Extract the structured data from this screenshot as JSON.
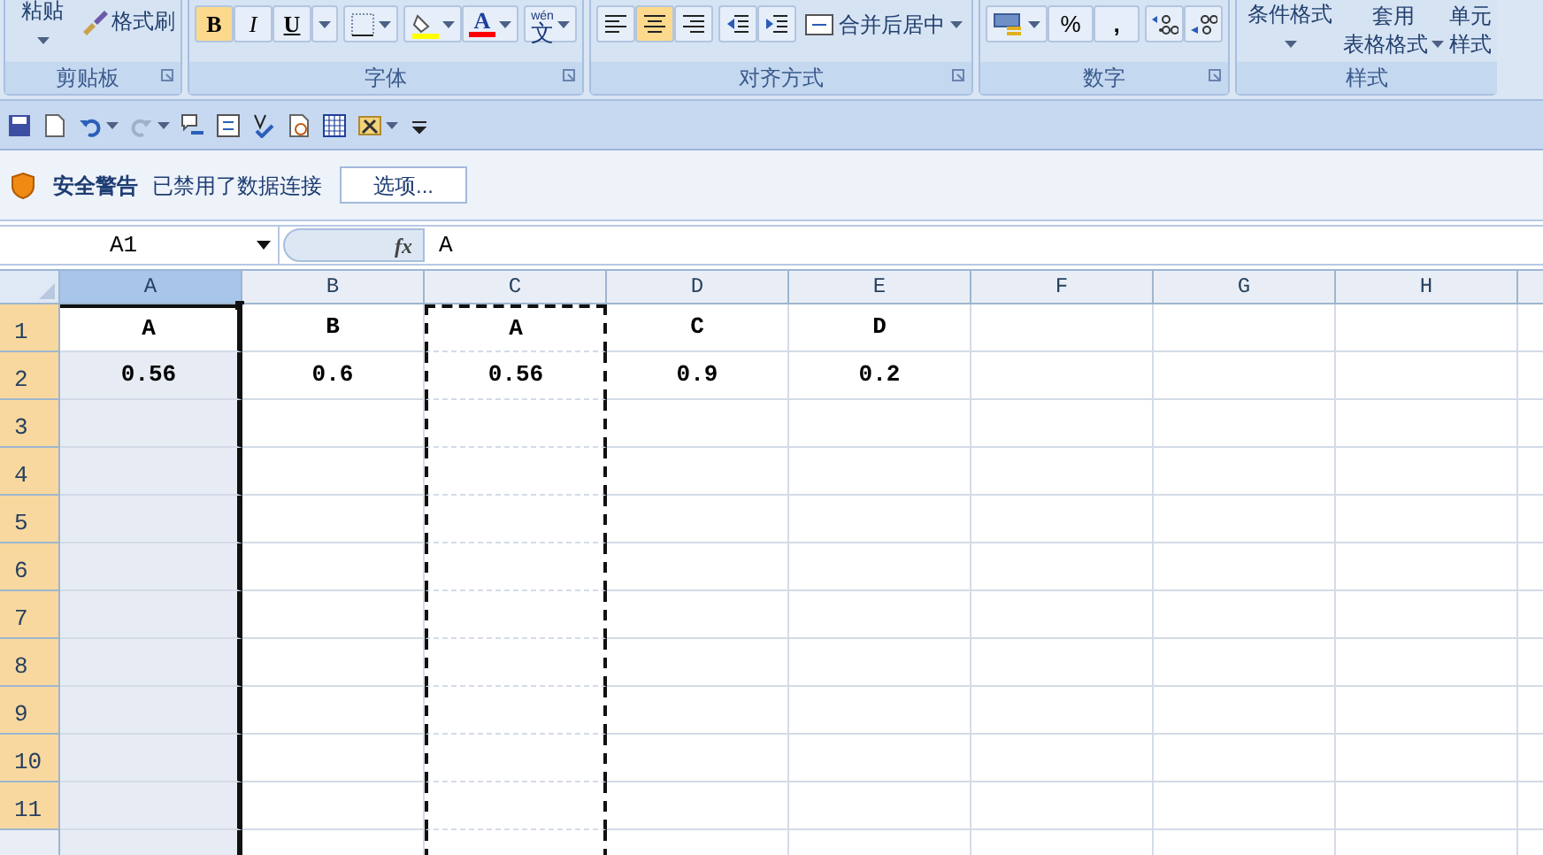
{
  "ribbon": {
    "clipboard": {
      "label": "剪贴板",
      "paste": "粘贴",
      "format_painter": "格式刷"
    },
    "font": {
      "label": "字体",
      "bold": {
        "label": "B",
        "selected": true
      },
      "italic": {
        "label": "I",
        "selected": false
      },
      "underline": {
        "label": "U",
        "selected": false
      },
      "font_color": "A",
      "phonetic": {
        "ruby": "wén",
        "char": "文"
      }
    },
    "alignment": {
      "label": "对齐方式",
      "align": [
        {
          "selected": false
        },
        {
          "selected": true
        },
        {
          "selected": false
        }
      ],
      "merge": "合并后居中"
    },
    "number": {
      "label": "数字",
      "percent": "%",
      "comma": ","
    },
    "styles": {
      "label": "样式",
      "conditional": "条件格式",
      "table_top": "套用",
      "table_bottom": "表格格式",
      "cell_top": "单元",
      "cell_bottom": "样式"
    }
  },
  "security_bar": {
    "title": "安全警告",
    "message": "已禁用了数据连接",
    "button": "选项..."
  },
  "formula_bar": {
    "name_box": "A1",
    "fx": "fx",
    "value": "A"
  },
  "sheet": {
    "columns": [
      {
        "label": "A",
        "selected": true,
        "copy_marquee": false
      },
      {
        "label": "B",
        "selected": false,
        "copy_marquee": false
      },
      {
        "label": "C",
        "selected": false,
        "copy_marquee": true
      },
      {
        "label": "D",
        "selected": false,
        "copy_marquee": false
      },
      {
        "label": "E",
        "selected": false,
        "copy_marquee": false
      },
      {
        "label": "F",
        "selected": false,
        "copy_marquee": false
      },
      {
        "label": "G",
        "selected": false,
        "copy_marquee": false
      },
      {
        "label": "H",
        "selected": false,
        "copy_marquee": false
      }
    ],
    "rows": [
      {
        "label": "1",
        "selected": true,
        "cells": [
          {
            "value": "A",
            "active": true
          },
          {
            "value": "B",
            "active": false
          },
          {
            "value": "A",
            "active": false
          },
          {
            "value": "C",
            "active": false
          },
          {
            "value": "D",
            "active": false
          }
        ]
      },
      {
        "label": "2",
        "selected": true,
        "cells": [
          {
            "value": "0.56",
            "active": false
          },
          {
            "value": "0.6",
            "active": false
          },
          {
            "value": "0.56",
            "active": false
          },
          {
            "value": "0.9",
            "active": false
          },
          {
            "value": "0.2",
            "active": false
          }
        ]
      },
      {
        "label": "3",
        "selected": true
      },
      {
        "label": "4",
        "selected": true
      },
      {
        "label": "5",
        "selected": true
      },
      {
        "label": "6",
        "selected": true
      },
      {
        "label": "7",
        "selected": true
      },
      {
        "label": "8",
        "selected": true
      },
      {
        "label": "9",
        "selected": true
      },
      {
        "label": "10",
        "selected": true
      },
      {
        "label": "11",
        "selected": true
      }
    ]
  }
}
